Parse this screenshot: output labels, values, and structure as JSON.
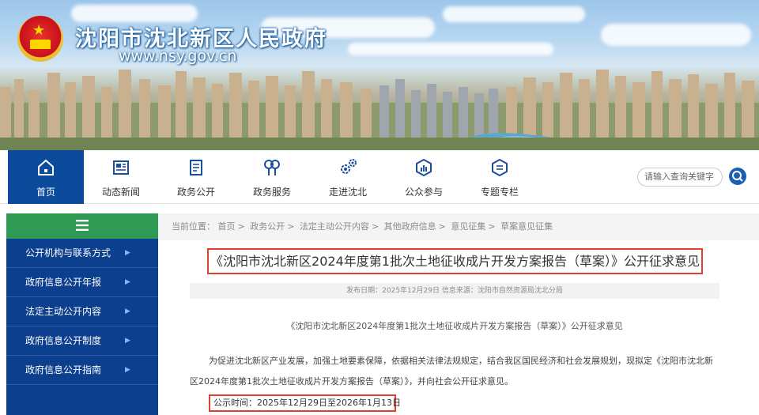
{
  "header": {
    "site_name": "沈阳市沈北新区人民政府",
    "site_url": "www.nsy.gov.cn"
  },
  "nav": {
    "items": [
      {
        "label": "首页",
        "icon": "home-icon",
        "active": true
      },
      {
        "label": "动态新闻",
        "icon": "news-icon"
      },
      {
        "label": "政务公开",
        "icon": "document-icon"
      },
      {
        "label": "政务服务",
        "icon": "service-icon"
      },
      {
        "label": "走进沈北",
        "icon": "gears-icon"
      },
      {
        "label": "公众参与",
        "icon": "participation-icon"
      },
      {
        "label": "专题专栏",
        "icon": "topic-icon"
      }
    ],
    "search_placeholder": "请输入查询关键字"
  },
  "sidebar": {
    "items": [
      {
        "label": "公开机构与联系方式"
      },
      {
        "label": "政府信息公开年报"
      },
      {
        "label": "法定主动公开内容"
      },
      {
        "label": "政府信息公开制度"
      },
      {
        "label": "政府信息公开指南"
      }
    ]
  },
  "breadcrumb": {
    "prefix": "当前位置：",
    "items": [
      "首页",
      "政务公开",
      "法定主动公开内容",
      "其他政府信息",
      "意见征集",
      "草案意见征集"
    ]
  },
  "article": {
    "title": "《沈阳市沈北新区2024年度第1批次土地征收成片开发方案报告（草案）》公开征求意见",
    "meta": "发布日期：2025年12月29日   信息来源：沈阳市自然资源局沈北分局",
    "subhead": "《沈阳市沈北新区2024年度第1批次土地征收成片开发方案报告（草案）》公开征求意见",
    "paragraph": "为促进沈北新区产业发展，加强土地要素保障，依据相关法律法规规定，结合我区国民经济和社会发展规划，现拟定《沈阳市沈北新区2024年度第1批次土地征收成片开发方案报告（草案）》，并向社会公开征求意见。",
    "notice": "公示时间：2025年12月29日至2026年1月13日"
  },
  "colors": {
    "nav_active": "#0c4a9c",
    "sidebar_bg": "#0d3f8f",
    "sidebar_head": "#2e9a53",
    "highlight_border": "#e0402f"
  }
}
